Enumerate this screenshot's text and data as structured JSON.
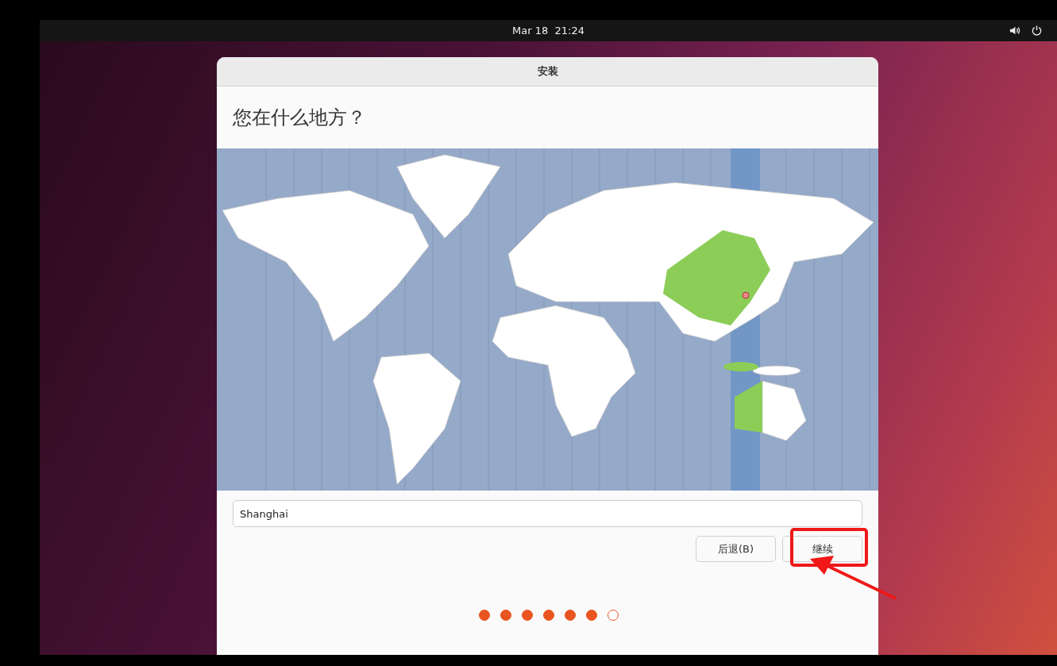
{
  "top_bar": {
    "date_time": "Mar 18  21:24"
  },
  "window": {
    "title": "安装"
  },
  "heading": "您在什么地方？",
  "location_field": {
    "value": "Shanghai"
  },
  "buttons": [
    {
      "label": "后退(B)"
    },
    {
      "label": "继续"
    }
  ],
  "progress_steps": [
    {
      "completed": true
    },
    {
      "completed": true
    },
    {
      "completed": true
    },
    {
      "completed": true
    },
    {
      "completed": true
    },
    {
      "completed": true
    },
    {
      "completed": false
    }
  ]
}
